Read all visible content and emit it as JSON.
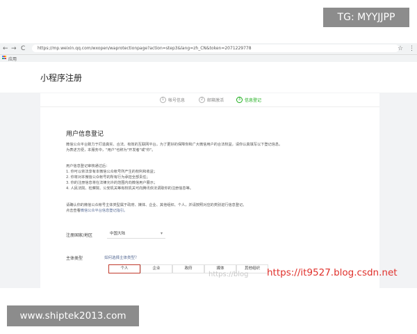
{
  "watermarks": {
    "top_right": "TG: MYYJJPP",
    "bottom_left": "www.shiptek2013.com",
    "faint": "https://blog",
    "red": "https://it9527.blog.csdn.net"
  },
  "browser": {
    "back": "←",
    "forward": "→",
    "reload": "C",
    "url": "https://mp.weixin.qq.com/wxopen/waprotectionpage?action=step3&lang=zh_CN&token=2071229778",
    "star": "☆",
    "menu": "⋮",
    "bookmark_label": "应用"
  },
  "page": {
    "title": "小程序注册"
  },
  "steps": [
    {
      "num": "1",
      "label": "帐号信息"
    },
    {
      "num": "2",
      "label": "邮箱激活"
    },
    {
      "num": "3",
      "label": "信息登记"
    }
  ],
  "content": {
    "section_title": "用户信息登记",
    "intro_1": "微信公众平台致力于打造真实、合法、有效的互联网平台。为了更好的保障你和广大微信用户的合法权益，请你认真填写以下登记信息。",
    "intro_2": "为表述方便，本服务中，\"用户\"也称为\"开发者\"或\"你\"。",
    "rules_title": "用户信息登记审核通过后：",
    "rule_1": "1. 你可以依法享有本微信公众帐号所产生的权利和收益；",
    "rule_2": "2. 你将对本微信公众帐号的所有行为承担全部责任；",
    "rule_3": "3. 你的注册信息将在法律允许的范围内向微信用户展示；",
    "rule_4": "4. 人民法院、检察院、公安机关等有权机关可向腾讯依法调取你的注册信息等。",
    "confirm_1": "请确认你的微信公众帐号主体类型属于政府、媒体、企业、其他组织、个人，并请按照对应的类别进行信息登记。",
    "confirm_2_prefix": "点击查看",
    "confirm_2_link": "微信公众平台信息登记指引。"
  },
  "form": {
    "region_label": "注册国家/地区",
    "region_value": "中国大陆",
    "type_label": "主体类型",
    "type_hint": "如何选择主体类型？",
    "types": [
      "个人",
      "企业",
      "政府",
      "媒体",
      "其他组织"
    ]
  }
}
